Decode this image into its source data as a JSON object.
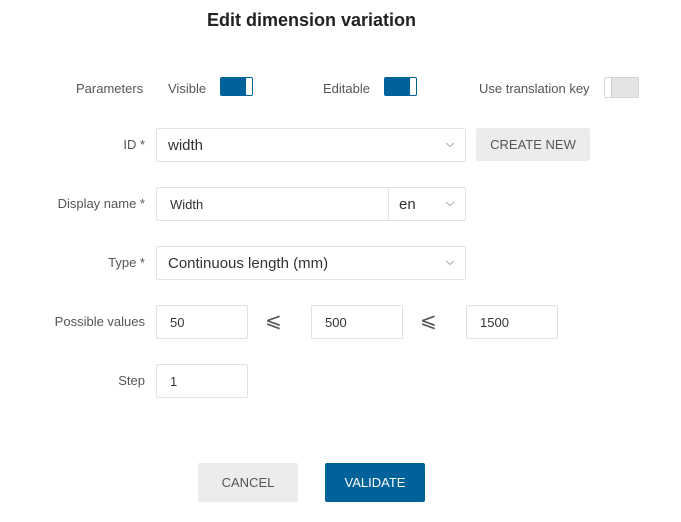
{
  "dialog": {
    "title": "Edit dimension variation"
  },
  "parameters": {
    "label": "Parameters",
    "visible": {
      "label": "Visible",
      "on": true
    },
    "editable": {
      "label": "Editable",
      "on": true
    },
    "translation_key": {
      "label": "Use translation key",
      "on": false
    }
  },
  "id_field": {
    "label": "ID *",
    "value": "width",
    "create_new_label": "CREATE NEW"
  },
  "display_name": {
    "label": "Display name *",
    "value": "Width",
    "language": "en"
  },
  "type_field": {
    "label": "Type *",
    "value": "Continuous length (mm)"
  },
  "possible_values": {
    "label": "Possible values",
    "min": "50",
    "default": "500",
    "max": "1500",
    "comparator": "⩽"
  },
  "step": {
    "label": "Step",
    "value": "1"
  },
  "actions": {
    "cancel_label": "CANCEL",
    "validate_label": "VALIDATE"
  },
  "colors": {
    "accent": "#00629b",
    "secondary_button": "#ececec",
    "toggle_off": "#e4e4e4"
  }
}
